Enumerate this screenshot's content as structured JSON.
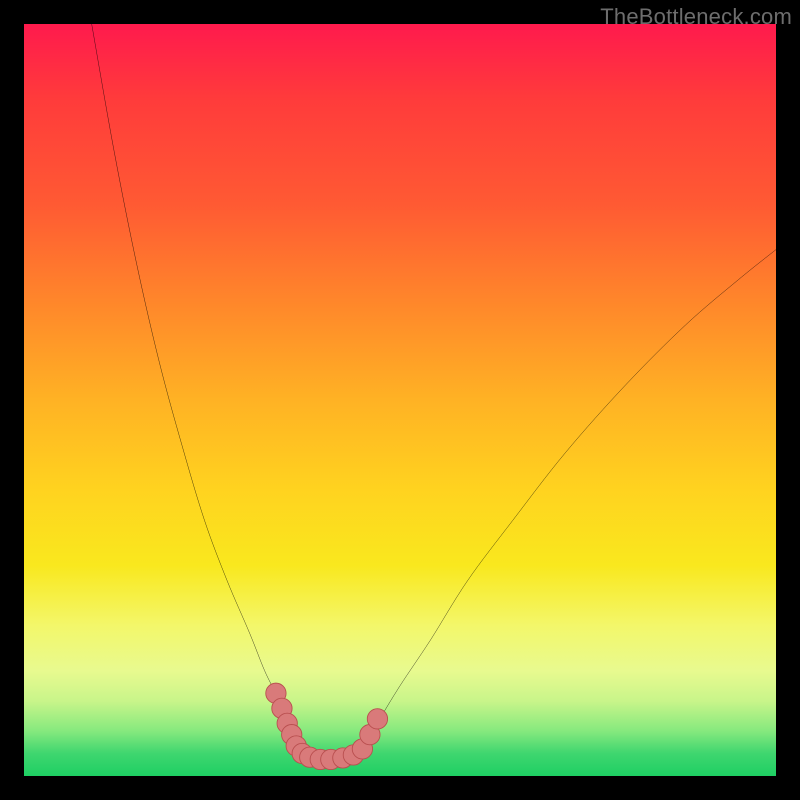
{
  "watermark": "TheBottleneck.com",
  "colors": {
    "background": "#000000",
    "curve": "#000000",
    "marker_fill": "#d97a7a",
    "marker_stroke": "#b94f4f"
  },
  "chart_data": {
    "type": "line",
    "title": "",
    "xlabel": "",
    "ylabel": "",
    "xlim": [
      0,
      100
    ],
    "ylim": [
      0,
      100
    ],
    "grid": false,
    "legend": false,
    "note": "Axes and labels not shown in image; values estimated from geometry on a 0–100 normalized scale where y increases downward.",
    "series": [
      {
        "name": "left-curve",
        "x": [
          9,
          12,
          15,
          18,
          21,
          24,
          27,
          30,
          32,
          33.5,
          35,
          36.5,
          38
        ],
        "y": [
          0,
          17,
          32,
          45,
          56,
          66,
          74,
          81,
          86,
          89,
          92,
          95,
          97
        ]
      },
      {
        "name": "right-curve",
        "x": [
          45,
          47,
          50,
          54,
          59,
          65,
          72,
          80,
          88,
          95,
          100
        ],
        "y": [
          97,
          93,
          88,
          82,
          74,
          66,
          57,
          48,
          40,
          34,
          30
        ]
      }
    ],
    "markers": {
      "name": "salmon-dots-near-trough",
      "points_xy": [
        [
          33.5,
          89
        ],
        [
          34.3,
          91
        ],
        [
          35.0,
          93
        ],
        [
          35.6,
          94.5
        ],
        [
          36.2,
          96
        ],
        [
          37.0,
          97
        ],
        [
          38.0,
          97.5
        ],
        [
          39.4,
          97.8
        ],
        [
          40.8,
          97.8
        ],
        [
          42.4,
          97.6
        ],
        [
          43.8,
          97.2
        ],
        [
          45.0,
          96.4
        ],
        [
          46.0,
          94.5
        ],
        [
          47.0,
          92.4
        ]
      ]
    }
  }
}
